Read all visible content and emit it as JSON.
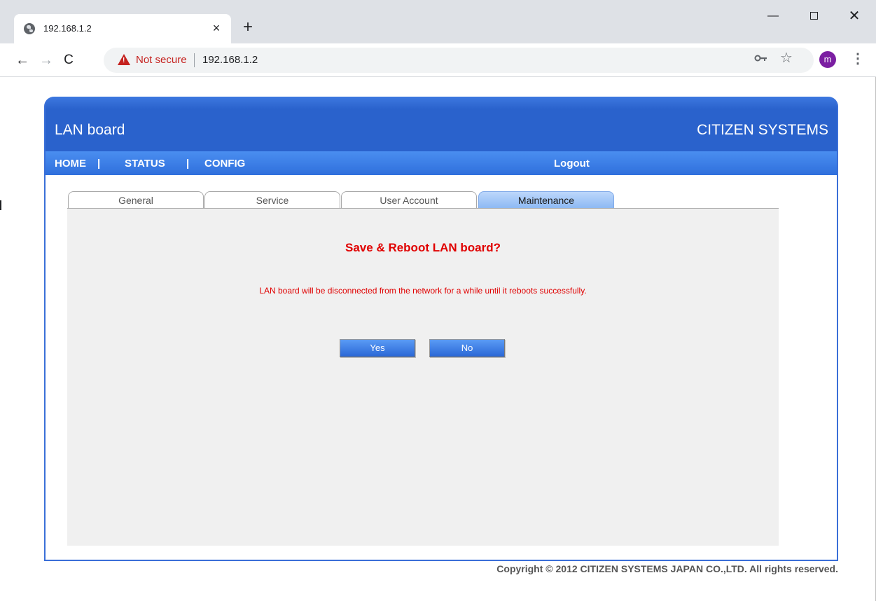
{
  "browser": {
    "tab_title": "192.168.1.2",
    "tab_close": "×",
    "new_tab": "+",
    "security_label": "Not secure",
    "url": "192.168.1.2",
    "profile_initial": "m",
    "window": {
      "minimize": "—",
      "close": "✕"
    },
    "nav": {
      "back": "←",
      "forward": "→",
      "reload": "C"
    },
    "icons": {
      "star": "☆",
      "menu": "⋮",
      "warning": "!"
    }
  },
  "header": {
    "product": "LAN board",
    "brand": "CITIZEN SYSTEMS"
  },
  "menu": {
    "home": "HOME",
    "separator": "|",
    "status": "STATUS",
    "config": "CONFIG",
    "logout": "Logout"
  },
  "tabs": [
    {
      "label": "General"
    },
    {
      "label": "Service"
    },
    {
      "label": "User Account"
    },
    {
      "label": "Maintenance",
      "active": true
    }
  ],
  "dialog": {
    "title": "Save & Reboot LAN board?",
    "message": "LAN board will be disconnected from the network for a while until it reboots successfully.",
    "yes_label": "Yes",
    "no_label": "No"
  },
  "footer": {
    "copyright": "Copyright © 2012 CITIZEN SYSTEMS JAPAN CO.,LTD. All rights reserved."
  },
  "colors": {
    "header_blue": "#2a62cc",
    "alert_red": "#e00000",
    "profile_purple": "#7b1fa2"
  }
}
